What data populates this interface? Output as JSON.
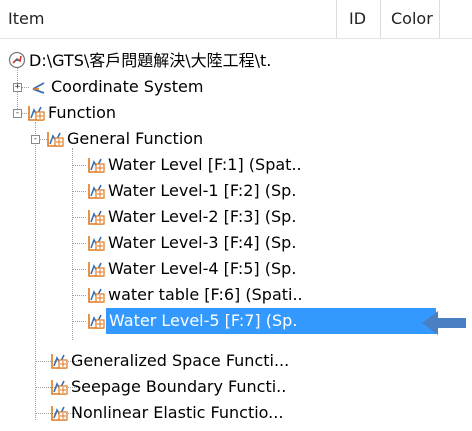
{
  "header": {
    "item": "Item",
    "id": "ID",
    "color": "Color"
  },
  "tree": {
    "root": {
      "label": "D:\\GTS\\客戶問題解決\\大陸工程\\t.",
      "icon": "project-icon"
    },
    "coordinate_system": {
      "label": "Coordinate System",
      "icon": "coordinate-system-icon",
      "expander": "+"
    },
    "function": {
      "label": "Function",
      "icon": "function-icon",
      "expander": "-"
    },
    "general_function": {
      "label": "General Function",
      "icon": "function-icon",
      "expander": "-"
    },
    "general_children": [
      {
        "label": "Water Level [F:1] (Spat.."
      },
      {
        "label": "Water Level-1 [F:2] (Sp."
      },
      {
        "label": "Water Level-2 [F:3] (Sp."
      },
      {
        "label": "Water Level-3 [F:4] (Sp."
      },
      {
        "label": "Water Level-4 [F:5] (Sp."
      },
      {
        "label": "water table [F:6] (Spati.."
      },
      {
        "label": "Water Level-5 [F:7] (Sp.",
        "selected": true
      }
    ],
    "function_siblings": [
      {
        "label": "Generalized Space Functi..."
      },
      {
        "label": "Seepage Boundary Functi.."
      },
      {
        "label": "Nonlinear Elastic Functio..."
      }
    ]
  },
  "colors": {
    "selection": "#3399ff",
    "arrow": "#4a7fc1",
    "icon_orange": "#e07a1f",
    "icon_blue": "#3a6fb5"
  }
}
